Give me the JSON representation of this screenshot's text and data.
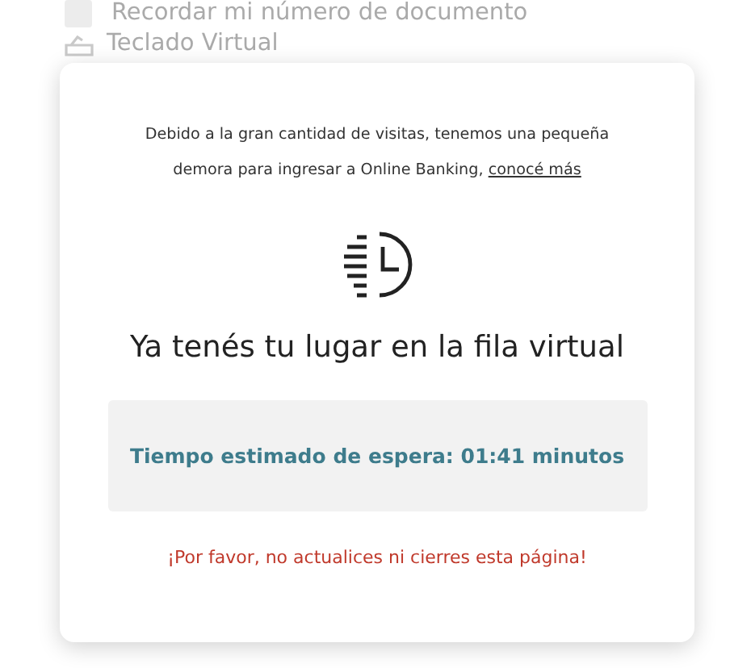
{
  "background": {
    "remember_checkbox": {
      "label": "Recordar mi número de documento",
      "checked": false
    },
    "virtual_keyboard": {
      "label": "Teclado Virtual"
    }
  },
  "modal": {
    "message": "Debido a la gran cantidad de visitas, tenemos una pequeña demora para ingresar a Online Banking, ",
    "link": "conocé más",
    "title": "Ya tenés tu lugar en la fila virtual",
    "wait_time": "Tiempo estimado de espera: 01:41 minutos",
    "warning": "¡Por favor, no actualices ni cierres esta página!"
  }
}
